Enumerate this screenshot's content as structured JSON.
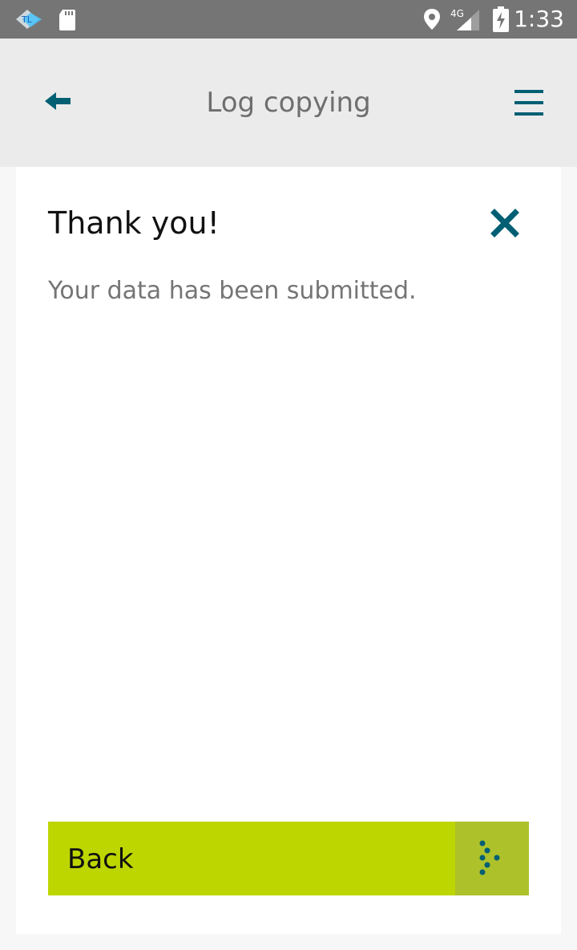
{
  "status_bar": {
    "network_label": "4G",
    "time": "1:33"
  },
  "app_bar": {
    "title": "Log copying"
  },
  "card": {
    "title": "Thank you!",
    "message": "Your data has been submitted."
  },
  "actions": {
    "back_label": "Back"
  },
  "colors": {
    "accent": "#005f73",
    "button": "#bed600",
    "button_arrow_bg": "#adc12a"
  },
  "icons": {
    "back": "arrow-left-icon",
    "menu": "hamburger-menu-icon",
    "close": "close-icon",
    "button": "dotted-chevron-right-icon"
  }
}
